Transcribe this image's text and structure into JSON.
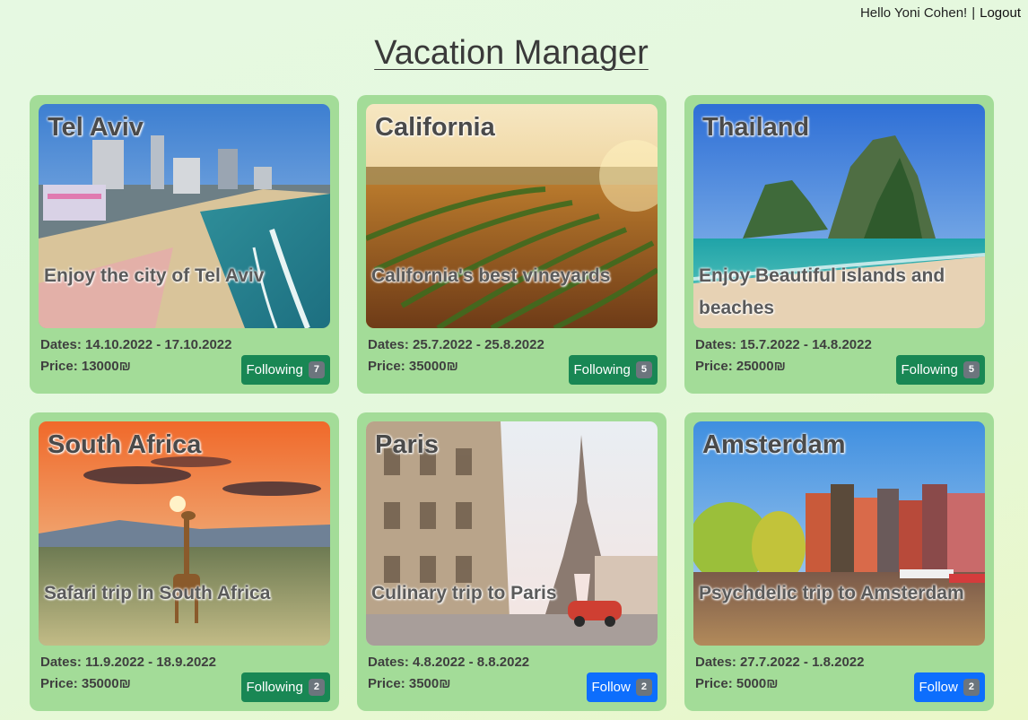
{
  "header": {
    "greeting": "Hello Yoni Cohen!",
    "separator": "|",
    "logout_label": "Logout",
    "title": "Vacation Manager"
  },
  "colors": {
    "following": "#198754",
    "follow": "#0d6efd",
    "card_bg": "#a3dc98",
    "badge": "#6c757d"
  },
  "vacations": [
    {
      "destination": "Tel Aviv",
      "description": "Enjoy the city of Tel Aviv",
      "dates": "Dates: 14.10.2022 - 17.10.2022",
      "price": "Price: 13000₪",
      "button": "Following",
      "followers": "7",
      "image": "city-beach-image"
    },
    {
      "destination": "California",
      "description": "California's best vineyards",
      "dates": "Dates: 25.7.2022 - 25.8.2022",
      "price": "Price: 35000₪",
      "button": "Following",
      "followers": "5",
      "image": "vineyard-image"
    },
    {
      "destination": "Thailand",
      "description": "Enjoy Beautiful islands and beaches",
      "dates": "Dates: 15.7.2022 - 14.8.2022",
      "price": "Price: 25000₪",
      "button": "Following",
      "followers": "5",
      "image": "island-beach-image"
    },
    {
      "destination": "South Africa",
      "description": "Safari trip in South Africa",
      "dates": "Dates: 11.9.2022 - 18.9.2022",
      "price": "Price: 35000₪",
      "button": "Following",
      "followers": "2",
      "image": "safari-sunset-image"
    },
    {
      "destination": "Paris",
      "description": "Culinary trip to Paris",
      "dates": "Dates: 4.8.2022 - 8.8.2022",
      "price": "Price: 3500₪",
      "button": "Follow",
      "followers": "2",
      "image": "eiffel-tower-image"
    },
    {
      "destination": "Amsterdam",
      "description": "Psychdelic trip to Amsterdam",
      "dates": "Dates: 27.7.2022 - 1.8.2022",
      "price": "Price: 5000₪",
      "button": "Follow",
      "followers": "2",
      "image": "canal-houses-image"
    }
  ]
}
